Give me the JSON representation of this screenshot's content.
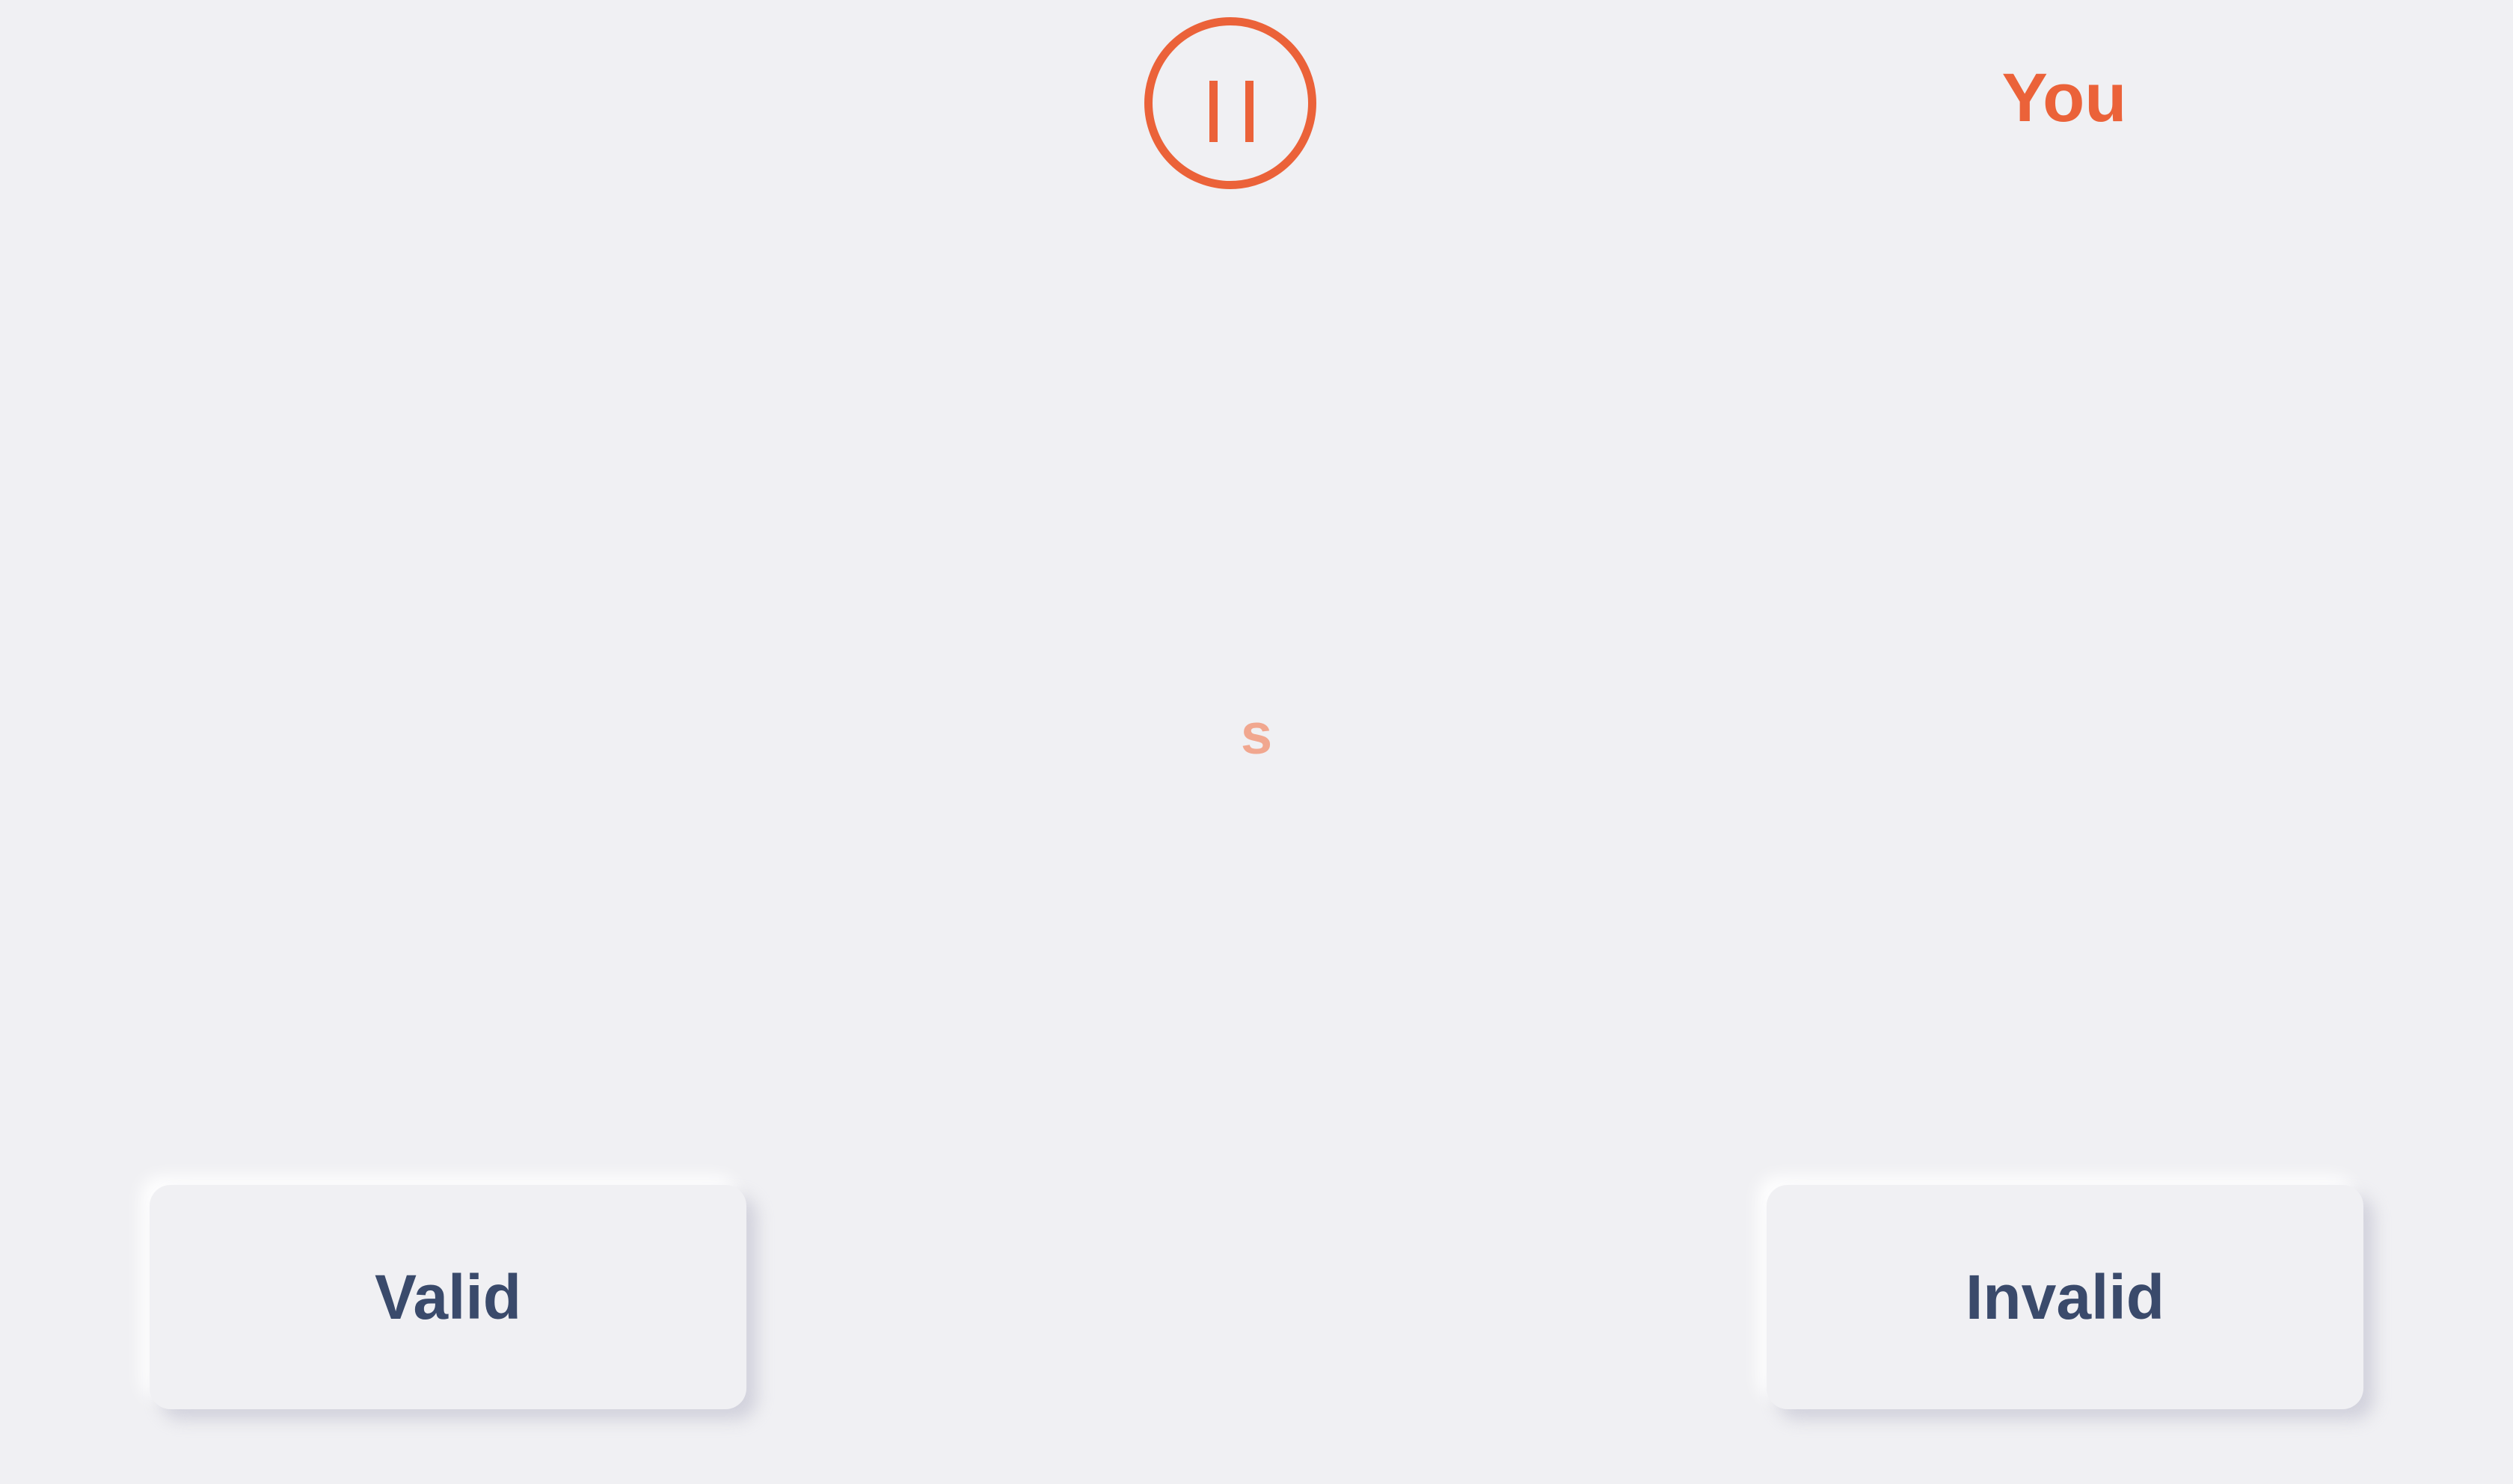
{
  "header": {
    "player_label": "You",
    "pause_icon": "pause-icon"
  },
  "prompt": {
    "letter": "s"
  },
  "buttons": {
    "valid_label": "Valid",
    "invalid_label": "Invalid"
  },
  "colors": {
    "accent": "#eb6239",
    "accent_faded": "#f1a78f",
    "text_dark": "#3a4a6b",
    "background": "#f0f0f3"
  }
}
